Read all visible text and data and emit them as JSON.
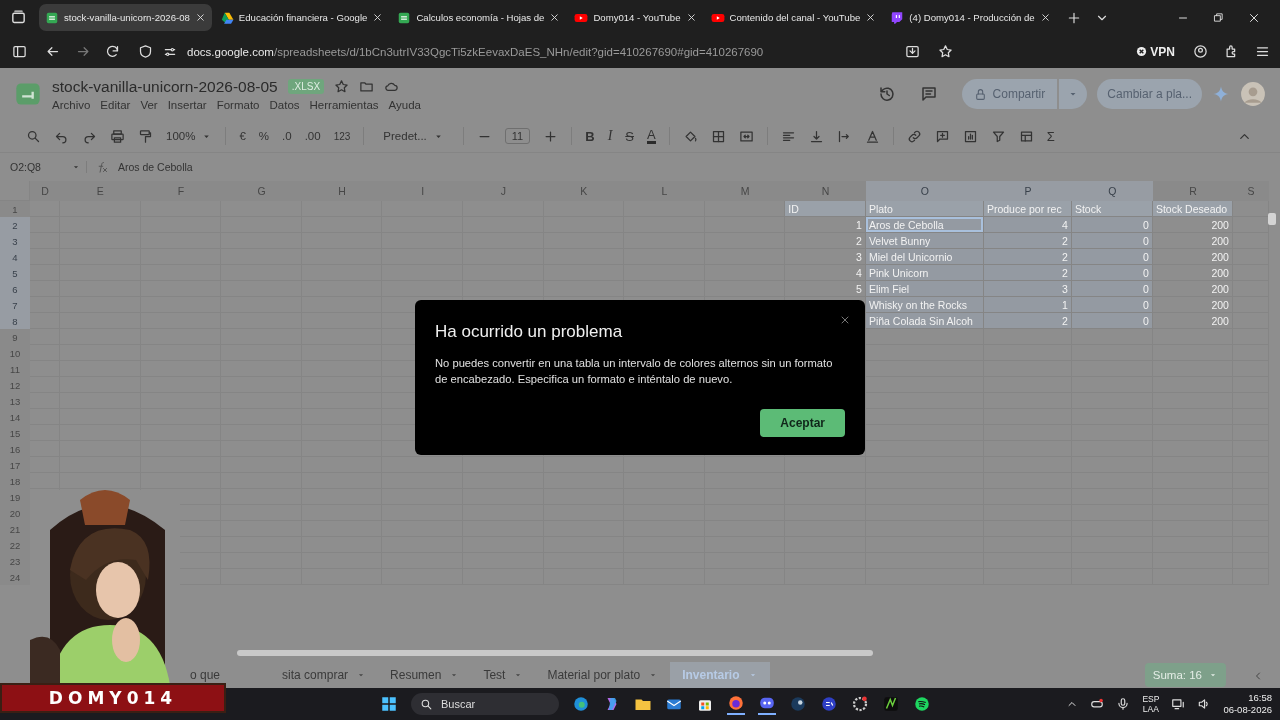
{
  "browser": {
    "tabs": [
      {
        "kind": "sheets",
        "label": "stock-vanilla-unicorn-2026-08",
        "selected": true
      },
      {
        "kind": "drive",
        "label": "Educación financiera - Google",
        "selected": false
      },
      {
        "kind": "sheets",
        "label": "Calculos economía - Hojas de",
        "selected": false
      },
      {
        "kind": "youtube",
        "label": "Domy014 - YouTube",
        "selected": false
      },
      {
        "kind": "youtube",
        "label": "Contenido del canal - YouTube",
        "selected": false
      },
      {
        "kind": "twitch",
        "label": "(4) Domy014 - Producción de",
        "selected": false
      }
    ],
    "url_host": "docs.google.com",
    "url_path": "/spreadsheets/d/1bCn3utrIV33QgcTi5zkEevaxDaES_NHn/edit?gid=410267690#gid=410267690",
    "vpn": "VPN"
  },
  "document": {
    "title": "stock-vanilla-unicorn-2026-08-05",
    "badge": ".XLSX",
    "menus": [
      "Archivo",
      "Editar",
      "Ver",
      "Insertar",
      "Formato",
      "Datos",
      "Herramientas",
      "Ayuda"
    ],
    "share": "Compartir",
    "switch": "Cambiar a pla..."
  },
  "toolbar": {
    "zoom": "100%",
    "currency": "€",
    "percent": "%",
    "decrease_decimals": ".0",
    "increase_decimals": ".00",
    "number_format": "123",
    "font": "Predet...",
    "font_size": "11",
    "bold": "B",
    "italic": "I",
    "strikethrough": "S",
    "text_color": "A",
    "functions": "Σ"
  },
  "formula_bar": {
    "range": "O2:Q8",
    "content": "Aros de Cebolla"
  },
  "sheet": {
    "columns": [
      {
        "label": "D",
        "selected": false
      },
      {
        "label": "E",
        "selected": false
      },
      {
        "label": "F",
        "selected": false
      },
      {
        "label": "G",
        "selected": false
      },
      {
        "label": "H",
        "selected": false
      },
      {
        "label": "I",
        "selected": false
      },
      {
        "label": "J",
        "selected": false
      },
      {
        "label": "K",
        "selected": false
      },
      {
        "label": "L",
        "selected": false
      },
      {
        "label": "M",
        "selected": false
      },
      {
        "label": "N",
        "selected": false
      },
      {
        "label": "O",
        "selected": true
      },
      {
        "label": "P",
        "selected": true
      },
      {
        "label": "Q",
        "selected": true
      },
      {
        "label": "R",
        "selected": false
      },
      {
        "label": "S",
        "selected": false
      }
    ],
    "row_numbers": [
      {
        "label": "1",
        "selected": false
      },
      {
        "label": "2",
        "selected": true
      },
      {
        "label": "3",
        "selected": true
      },
      {
        "label": "4",
        "selected": true
      },
      {
        "label": "5",
        "selected": true
      },
      {
        "label": "6",
        "selected": true
      },
      {
        "label": "7",
        "selected": true
      },
      {
        "label": "8",
        "selected": true
      },
      {
        "label": "9",
        "selected": false
      },
      {
        "label": "10",
        "selected": false
      },
      {
        "label": "11",
        "selected": false
      },
      {
        "label": "12",
        "selected": false
      },
      {
        "label": "13",
        "selected": false
      },
      {
        "label": "14",
        "selected": false
      },
      {
        "label": "15",
        "selected": false
      },
      {
        "label": "16",
        "selected": false
      },
      {
        "label": "17",
        "selected": false
      },
      {
        "label": "18",
        "selected": false
      },
      {
        "label": "19",
        "selected": false
      },
      {
        "label": "20",
        "selected": false
      },
      {
        "label": "21",
        "selected": false
      },
      {
        "label": "22",
        "selected": false
      },
      {
        "label": "23",
        "selected": false
      },
      {
        "label": "24",
        "selected": false
      }
    ],
    "table_header": [
      "ID",
      "Plato",
      "Produce por rec",
      "Stock",
      "Stock Deseado"
    ],
    "table_rows": [
      {
        "id": "1",
        "plato": "Aros de Cebolla",
        "produce_por_rec": "4",
        "stock": "0",
        "stock_deseado": "200"
      },
      {
        "id": "2",
        "plato": "Velvet Bunny",
        "produce_por_rec": "2",
        "stock": "0",
        "stock_deseado": "200"
      },
      {
        "id": "3",
        "plato": "Miel del Unicornio",
        "produce_por_rec": "2",
        "stock": "0",
        "stock_deseado": "200"
      },
      {
        "id": "4",
        "plato": "Pink Unicorn",
        "produce_por_rec": "2",
        "stock": "0",
        "stock_deseado": "200"
      },
      {
        "id": "5",
        "plato": "Elim Fiel",
        "produce_por_rec": "3",
        "stock": "0",
        "stock_deseado": "200"
      },
      {
        "plato": "Whisky on the Rocks",
        "produce_por_rec": "1",
        "stock": "0",
        "stock_deseado": "200"
      },
      {
        "plato": "Piña Colada Sin Alcoh",
        "produce_por_rec": "2",
        "stock": "0",
        "stock_deseado": "200"
      }
    ]
  },
  "sheet_tabs": [
    {
      "parts": [
        "o que",
        "sita comprar"
      ],
      "selected": false
    },
    {
      "parts": [
        "Resumen"
      ],
      "selected": false
    },
    {
      "parts": [
        "Test"
      ],
      "selected": false
    },
    {
      "parts": [
        "Material por plato"
      ],
      "selected": false
    },
    {
      "parts": [
        "Inventario"
      ],
      "selected": true
    }
  ],
  "sum": "Suma: 16",
  "dialog": {
    "title": "Ha ocurrido un problema",
    "message": "No puedes convertir en una tabla un intervalo de colores alternos sin un formato de encabezado. Especifica un formato e inténtalo de nuevo.",
    "button": "Aceptar"
  },
  "webcam": {
    "kind": "picture",
    "banner": "DOMY014"
  },
  "taskbar": {
    "search": "Buscar",
    "language": "ESP",
    "layout": "LAA",
    "time": "16:58",
    "date": "06-08-2026"
  }
}
